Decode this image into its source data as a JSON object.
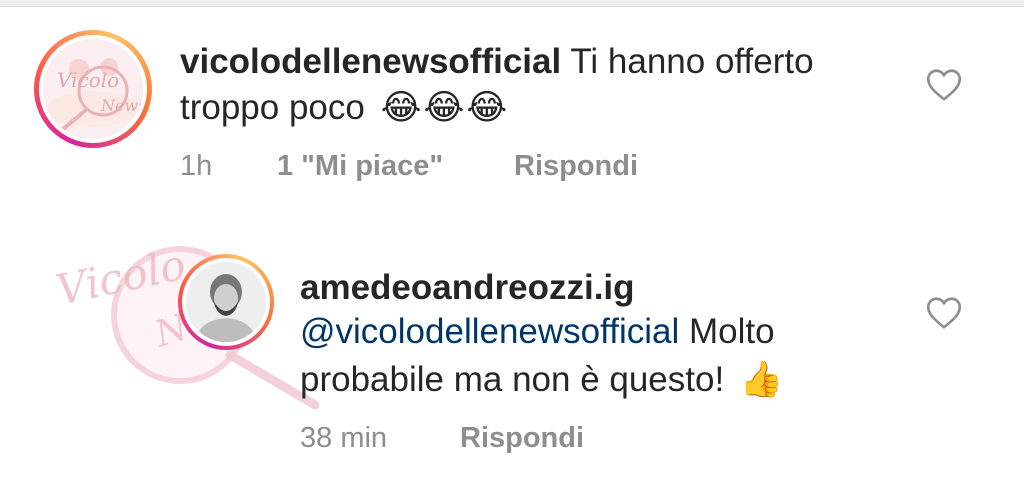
{
  "comments": [
    {
      "username": "vicolodellenewsofficial",
      "text_line1": "Ti hanno offerto",
      "text_line2": "troppo poco",
      "emoji": "😂😂😂",
      "time": "1h",
      "likes": "1 \"Mi piace\"",
      "reply": "Rispondi",
      "avatar_logo": "Vicolo delle News"
    },
    {
      "username": "amedeoandreozzi.ig",
      "mention": "@vicolodellenewsofficial",
      "text_line1": "Molto",
      "text_line2": "probabile ma non è questo!",
      "emoji": "👍",
      "time": "38 min",
      "reply": "Rispondi"
    }
  ],
  "watermark": "Vicolo delle News",
  "icons": [
    "heart-icon",
    "heart-icon"
  ]
}
